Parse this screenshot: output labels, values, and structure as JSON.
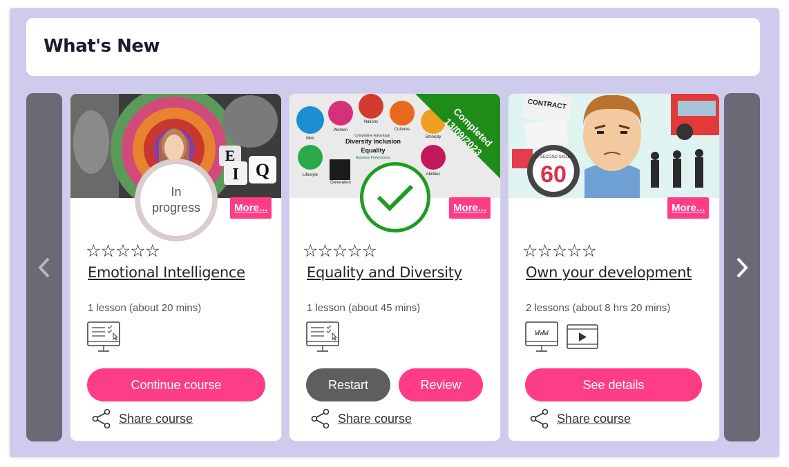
{
  "header": {
    "title": "What's New"
  },
  "cards": [
    {
      "title": "Emotional Intelligence",
      "more": "More...",
      "status_line1": "In",
      "status_line2": "progress",
      "rating": "☆☆☆☆☆",
      "lessons": "1 lesson (about 20 mins)",
      "button": "Continue course",
      "share": "Share course"
    },
    {
      "title": "Equality and Diversity",
      "more": "More...",
      "completed_label": "Completed",
      "completed_date": "13/09/2023",
      "rating": "☆☆☆☆☆",
      "lessons": "1 lesson (about 45 mins)",
      "button_restart": "Restart",
      "button_review": "Review",
      "share": "Share course",
      "thumb_labels": {
        "men": "Men",
        "women": "Women",
        "nations": "Nations",
        "cultures": "Cultures",
        "ethnicity": "Ethnicity",
        "competitive": "Competitive Advantage",
        "diversity": "Diversity Inclusion",
        "equality": "Equality",
        "business": "Business Performance",
        "lifestyle": "Lifestyle",
        "generation": "Generation",
        "abilities": "Abilities"
      }
    },
    {
      "title": "Own your development",
      "more": "More...",
      "rating": "☆☆☆☆☆",
      "lessons": "2 lessons (about 8 hrs 20 mins)",
      "button": "See details",
      "share": "Share course",
      "thumb_labels": {
        "contract": "CONTRACT",
        "skills": "60 SECOND SKILLS",
        "number": "60"
      }
    }
  ],
  "colors": {
    "accent": "#ff3d86",
    "completed": "#1f9c1f",
    "panel": "#cfcbec"
  }
}
